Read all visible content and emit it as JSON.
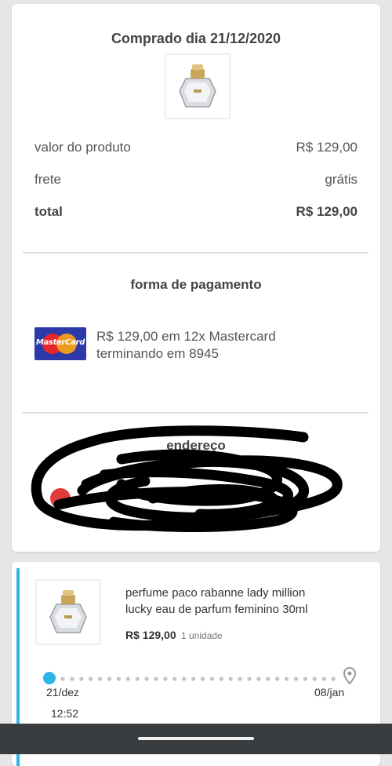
{
  "summary": {
    "purchase_date": "Comprado dia 21/12/2020",
    "product_image_icon": "perfume-bottle-icon",
    "rows": {
      "product_label": "valor do produto",
      "product_value": "R$ 129,00",
      "freight_label": "frete",
      "freight_value": "grátis",
      "total_label": "total",
      "total_value": "R$ 129,00"
    },
    "payment": {
      "title": "forma de pagamento",
      "card_brand": "MasterCard",
      "text_line1": "R$ 129,00 em 12x Mastercard",
      "text_line2": "terminando em 8945"
    },
    "address": {
      "title": "endereço",
      "redacted": true
    }
  },
  "item": {
    "image_icon": "perfume-bottle-icon",
    "name_line1": "perfume paco rabanne lady million",
    "name_line2": "lucky eau de parfum feminino 30ml",
    "price": "R$ 129,00",
    "quantity": "1 unidade",
    "timeline": {
      "start_date": "21/dez",
      "start_time": "12:52",
      "end_date": "08/jan"
    }
  },
  "colors": {
    "accent": "#2bb6e6",
    "card_bg": "#ffffff",
    "page_bg": "#e6e6e6",
    "nav_bar": "#3a3d40"
  }
}
